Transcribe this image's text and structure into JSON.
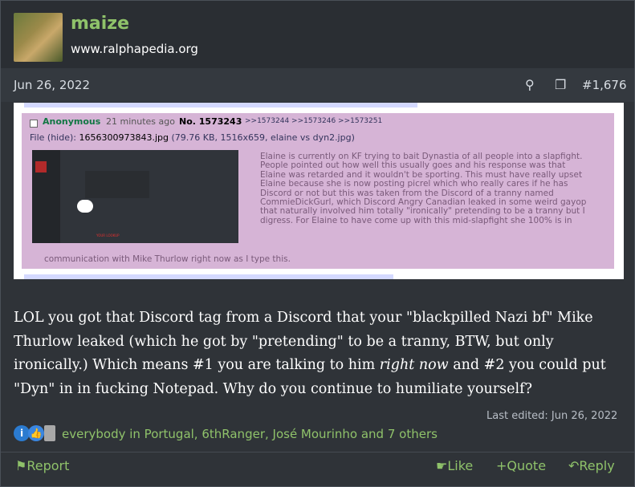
{
  "user": {
    "name": "maize",
    "title": "www.ralphapedia.org"
  },
  "meta": {
    "date": "Jun 26, 2022",
    "post_number": "#1,676"
  },
  "image": {
    "name": "Anonymous",
    "time": "21 minutes ago",
    "post_no": "No. 1573243",
    "reply_links": ">>1573244  >>1573246  >>1573251",
    "file_label": "File (hide):",
    "file_name": "1656300973843.jpg",
    "file_info": "(79.76 KB, 1516x659, elaine vs dyn2.jpg)",
    "thumb_text": "YOUR LOOKUP",
    "text": "Elaine is currently on KF trying to bait Dynastia of all people into a slapfight. People pointed out how well this usually goes and his response was that Elaine was retarded and it wouldn't be sporting. This must have really upset Elaine because she is now posting picrel which who really cares if he has Discord or not but this was taken from the Discord of a tranny named CommieDickGurl, which Discord Angry Canadian leaked in some weird gayop that naturally involved him totally \"ironically\" pretending to be a tranny but I digress. For Elaine to have come up with this mid-slapfight she 100% is in",
    "text_last": "communication with Mike Thurlow right now as I type this."
  },
  "body": {
    "part1": "LOL you got that Discord tag from a Discord that your \"blackpilled Nazi bf\" Mike Thurlow leaked (which he got by \"pretending\" to be a tranny, BTW, but only ironically.) Which means #1 you are talking to him ",
    "italic": "right now",
    "part2": " and #2 you could put \"Dyn\" in in fucking Notepad. Why do you continue to humiliate yourself?"
  },
  "edited": "Last edited: Jun 26, 2022",
  "reactions": {
    "users": "everybody in Portugal, 6thRanger, José Mourinho and 7 others",
    "icons": [
      "info-reaction-icon",
      "like-reaction-icon",
      "other-reaction-icon"
    ]
  },
  "footer": {
    "report": "Report",
    "like": "Like",
    "quote": "Quote",
    "reply": "Reply"
  },
  "colors": {
    "accent": "#8fc26a",
    "background": "#2f3338"
  }
}
